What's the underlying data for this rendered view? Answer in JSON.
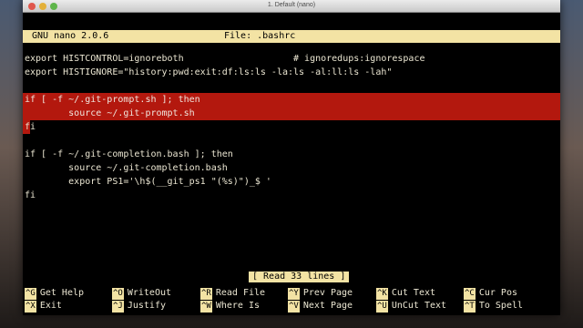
{
  "window": {
    "title": "1. Default (nano)"
  },
  "nano": {
    "version": "GNU nano 2.0.6",
    "file": "File: .bashrc"
  },
  "lines": [
    "export HISTCONTROL=ignoreboth                    # ignoredups:ignorespace",
    "export HISTIGNORE=\"history:pwd:exit:df:ls:ls -la:ls -al:ll:ls -lah\"",
    "",
    "if [ -f ~/.git-prompt.sh ]; then",
    "        source ~/.git-prompt.sh",
    "fi",
    "",
    "if [ -f ~/.git-completion.bash ]; then",
    "        source ~/.git-completion.bash",
    "        export PS1='\\h$(__git_ps1 \"(%s)\")_$ '",
    "fi"
  ],
  "status": "[ Read 33 lines ]",
  "shortcuts": [
    {
      "key": "^G",
      "label": "Get Help"
    },
    {
      "key": "^O",
      "label": "WriteOut"
    },
    {
      "key": "^R",
      "label": "Read File"
    },
    {
      "key": "^Y",
      "label": "Prev Page"
    },
    {
      "key": "^K",
      "label": "Cut Text"
    },
    {
      "key": "^C",
      "label": "Cur Pos"
    },
    {
      "key": "^X",
      "label": "Exit"
    },
    {
      "key": "^J",
      "label": "Justify"
    },
    {
      "key": "^W",
      "label": "Where Is"
    },
    {
      "key": "^V",
      "label": "Next Page"
    },
    {
      "key": "^U",
      "label": "UnCut Text"
    },
    {
      "key": "^T",
      "label": "To Spell"
    }
  ]
}
